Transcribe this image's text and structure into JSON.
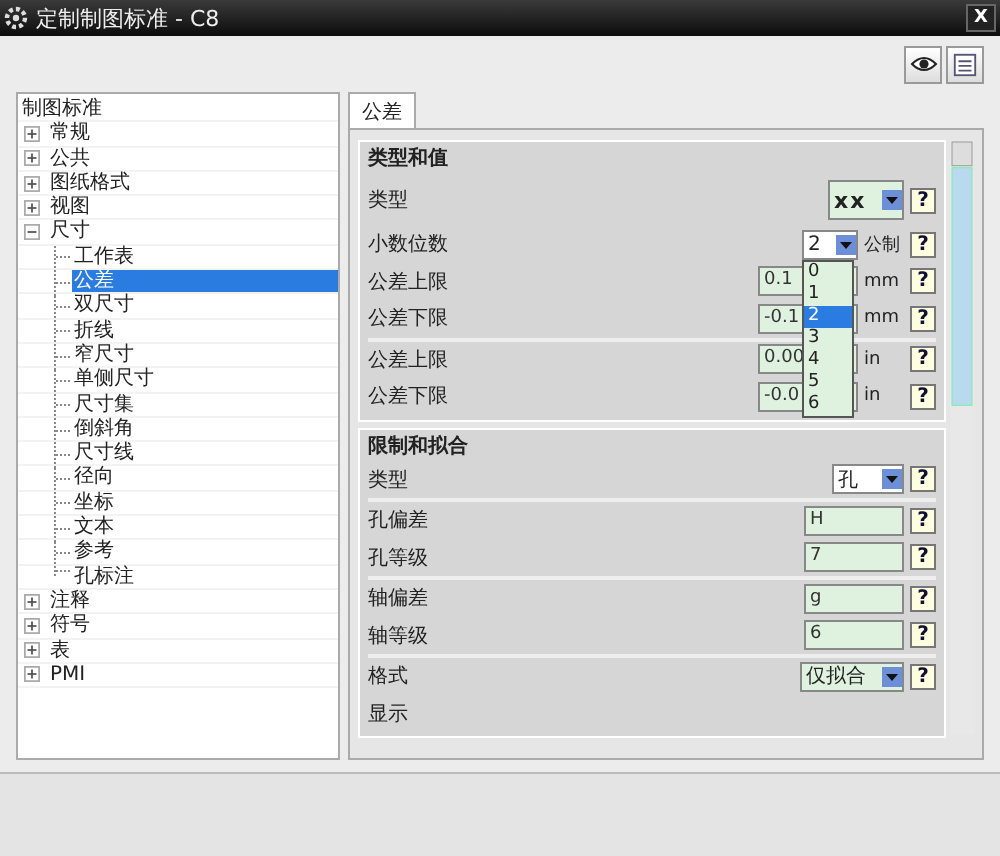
{
  "window": {
    "title": "定制制图标准 - C8",
    "close": "X"
  },
  "tree": {
    "root": "制图标准",
    "items": [
      {
        "label": "常规",
        "expanded": false,
        "selected": false
      },
      {
        "label": "公共",
        "expanded": false,
        "selected": false
      },
      {
        "label": "图纸格式",
        "expanded": false,
        "selected": false
      },
      {
        "label": "视图",
        "expanded": false,
        "selected": false
      },
      {
        "label": "尺寸",
        "expanded": true,
        "selected": false,
        "children": [
          {
            "label": "工作表",
            "selected": false
          },
          {
            "label": "公差",
            "selected": true
          },
          {
            "label": "双尺寸",
            "selected": false
          },
          {
            "label": "折线",
            "selected": false
          },
          {
            "label": "窄尺寸",
            "selected": false
          },
          {
            "label": "单侧尺寸",
            "selected": false
          },
          {
            "label": "尺寸集",
            "selected": false
          },
          {
            "label": "倒斜角",
            "selected": false
          },
          {
            "label": "尺寸线",
            "selected": false
          },
          {
            "label": "径向",
            "selected": false
          },
          {
            "label": "坐标",
            "selected": false
          },
          {
            "label": "文本",
            "selected": false
          },
          {
            "label": "参考",
            "selected": false
          },
          {
            "label": "孔标注",
            "selected": false
          }
        ]
      },
      {
        "label": "注释",
        "expanded": false,
        "selected": false
      },
      {
        "label": "符号",
        "expanded": false,
        "selected": false
      },
      {
        "label": "表",
        "expanded": false,
        "selected": false
      },
      {
        "label": "PMI",
        "expanded": false,
        "selected": false
      }
    ]
  },
  "tabs": [
    {
      "label": "公差",
      "selected": true
    }
  ],
  "sections": [
    {
      "title": "类型和值",
      "rows": [
        {
          "kind": "combo",
          "label": "类型",
          "value": "xx",
          "large": true,
          "help": "?"
        },
        {
          "kind": "combo",
          "label": "小数位数",
          "value": "2",
          "unit": "公制",
          "help": "?",
          "open": true,
          "options": [
            {
              "label": "0",
              "selected": false
            },
            {
              "label": "1",
              "selected": false
            },
            {
              "label": "2",
              "selected": true
            },
            {
              "label": "3",
              "selected": false
            },
            {
              "label": "4",
              "selected": false
            },
            {
              "label": "5",
              "selected": false
            },
            {
              "label": "6",
              "selected": false
            }
          ]
        },
        {
          "kind": "field",
          "label": "公差上限",
          "value": "0.1",
          "unit": "mm",
          "help": "?"
        },
        {
          "kind": "field",
          "label": "公差下限",
          "value": "-0.1",
          "unit": "mm",
          "help": "?",
          "divider": true
        },
        {
          "kind": "field",
          "label": "公差上限",
          "value": "0.00",
          "unit": "in",
          "help": "?"
        },
        {
          "kind": "field",
          "label": "公差下限",
          "value": "-0.0",
          "unit": "in",
          "help": "?"
        }
      ]
    },
    {
      "title": "限制和拟合",
      "rows": [
        {
          "kind": "combo",
          "label": "类型",
          "value": "孔",
          "help": "?",
          "divider": true
        },
        {
          "kind": "field",
          "label": "孔偏差",
          "value": "H",
          "help": "?"
        },
        {
          "kind": "field",
          "label": "孔等级",
          "value": "7",
          "help": "?",
          "divider": true
        },
        {
          "kind": "field",
          "label": "轴偏差",
          "value": "g",
          "help": "?"
        },
        {
          "kind": "field",
          "label": "轴等级",
          "value": "6",
          "help": "?",
          "divider": true
        },
        {
          "kind": "combo",
          "label": "格式",
          "value": "仅拟合",
          "wide": true,
          "help": "?"
        },
        {
          "kind": "text",
          "label": "显示"
        }
      ]
    }
  ]
}
